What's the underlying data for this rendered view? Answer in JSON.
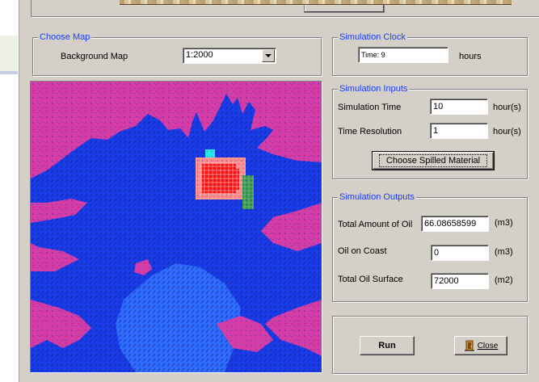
{
  "window": {
    "accent_legend_color": "#1a3cff"
  },
  "choose_map": {
    "legend": "Choose Map",
    "background_map_label": "Background Map",
    "background_map_value": "1:2000"
  },
  "simulation_clock": {
    "legend": "Simulation Clock",
    "time_value": "Time: 9",
    "unit": "hours"
  },
  "simulation_inputs": {
    "legend": "Simulation Inputs",
    "simulation_time_label": "Simulation Time",
    "simulation_time_value": "10",
    "simulation_time_unit": "hour(s)",
    "time_resolution_label": "Time Resolution",
    "time_resolution_value": "1",
    "time_resolution_unit": "hour(s)",
    "choose_spilled_label": "Choose Spilled Material"
  },
  "simulation_outputs": {
    "legend": "Simulation Outputs",
    "total_oil_label": "Total Amount of Oil",
    "total_oil_value": "66.08658599",
    "total_oil_unit": "(m3)",
    "oil_on_coast_label": "Oil on Coast",
    "oil_on_coast_value": "0",
    "oil_on_coast_unit": "(m3)",
    "total_surface_label": "Total Oil Surface",
    "total_surface_value": "72000",
    "total_surface_unit": "(m2)"
  },
  "actions": {
    "run_label": "Run",
    "close_label": "Close"
  },
  "map_colors": {
    "land": "#d43ca8",
    "water": "#1a3ce8",
    "water_light": "#2f6bff",
    "oil_high": "#ff1010",
    "oil_mid": "#ff8080",
    "oil_cyan": "#26e8e8",
    "oil_green": "#2a9a4a"
  }
}
